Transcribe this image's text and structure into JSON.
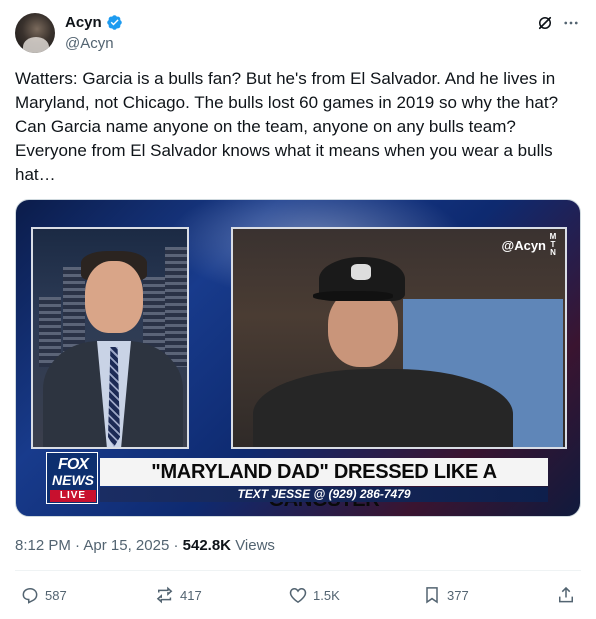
{
  "author": {
    "display_name": "Acyn",
    "handle": "@Acyn",
    "verified": true
  },
  "tweet": {
    "text": "Watters: Garcia is a bulls fan? But he's from El Salvador. And he lives in Maryland, not Chicago. The bulls lost 60 games in 2019 so why the hat? Can Garcia name anyone on the team, anyone on any bulls team? Everyone from El Salvador knows what it means when you wear a bulls hat…"
  },
  "media": {
    "watermark": "@Acyn",
    "watermark_logo": "M T N",
    "network_logo_top": "FOX",
    "network_logo_bottom": "NEWS",
    "live_label": "LIVE",
    "chyron_headline": "\"MARYLAND DAD\" DRESSED LIKE A GANGSTER",
    "chyron_subline": "TEXT JESSE @ (929) 286-7479"
  },
  "meta": {
    "time": "8:12 PM",
    "date": "Apr 15, 2025",
    "views_count": "542.8K",
    "views_label": "Views"
  },
  "actions": {
    "replies": "587",
    "reposts": "417",
    "likes": "1.5K",
    "bookmarks": "377"
  },
  "colors": {
    "verified_blue": "#1d9bf0",
    "secondary_text": "#536471",
    "primary_text": "#0f1419",
    "fox_red": "#c8102e"
  },
  "icons": [
    "verified-badge-icon",
    "grok-icon",
    "more-icon",
    "reply-icon",
    "repost-icon",
    "like-icon",
    "bookmark-icon",
    "share-icon"
  ]
}
